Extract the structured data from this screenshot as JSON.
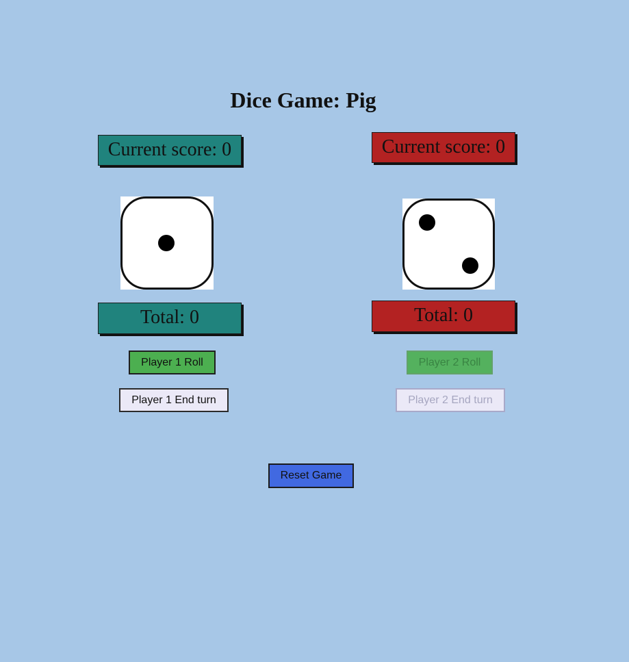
{
  "title": "Dice Game: Pig",
  "player1": {
    "current_score_label": "Current score: 0",
    "total_label": "Total: 0",
    "die_value": 1,
    "roll_label": "Player 1 Roll",
    "end_turn_label": "Player 1 End turn",
    "buttons_enabled": true,
    "color": "#20837d"
  },
  "player2": {
    "current_score_label": "Current score: 0",
    "total_label": "Total: 0",
    "die_value": 2,
    "roll_label": "Player 2 Roll",
    "end_turn_label": "Player 2 End turn",
    "buttons_enabled": false,
    "color": "#b32222"
  },
  "reset_label": "Reset Game",
  "colors": {
    "background": "#a7c7e7",
    "roll_button": "#4caf50",
    "end_turn_button": "#ebe9f7",
    "reset_button": "#4169e1"
  }
}
